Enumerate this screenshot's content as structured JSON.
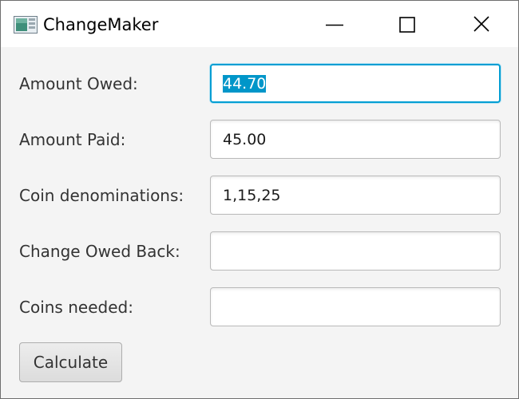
{
  "window": {
    "title": "ChangeMaker",
    "icon": "java-app-icon",
    "controls": [
      "minimize-icon",
      "maximize-icon",
      "close-icon"
    ]
  },
  "form": {
    "amount_owed": {
      "label": "Amount Owed:",
      "value": "44.70"
    },
    "amount_paid": {
      "label": "Amount Paid:",
      "value": "45.00"
    },
    "coin_denominations": {
      "label": "Coin denominations:",
      "value": "1,15,25"
    },
    "change_owed_back": {
      "label": "Change Owed Back:",
      "value": ""
    },
    "coins_needed": {
      "label": "Coins needed:",
      "value": ""
    }
  },
  "actions": {
    "calculate_label": "Calculate"
  },
  "colors": {
    "focus_accent": "#039ed3",
    "selection": "#0096c9",
    "window_bg": "#f4f4f4"
  }
}
